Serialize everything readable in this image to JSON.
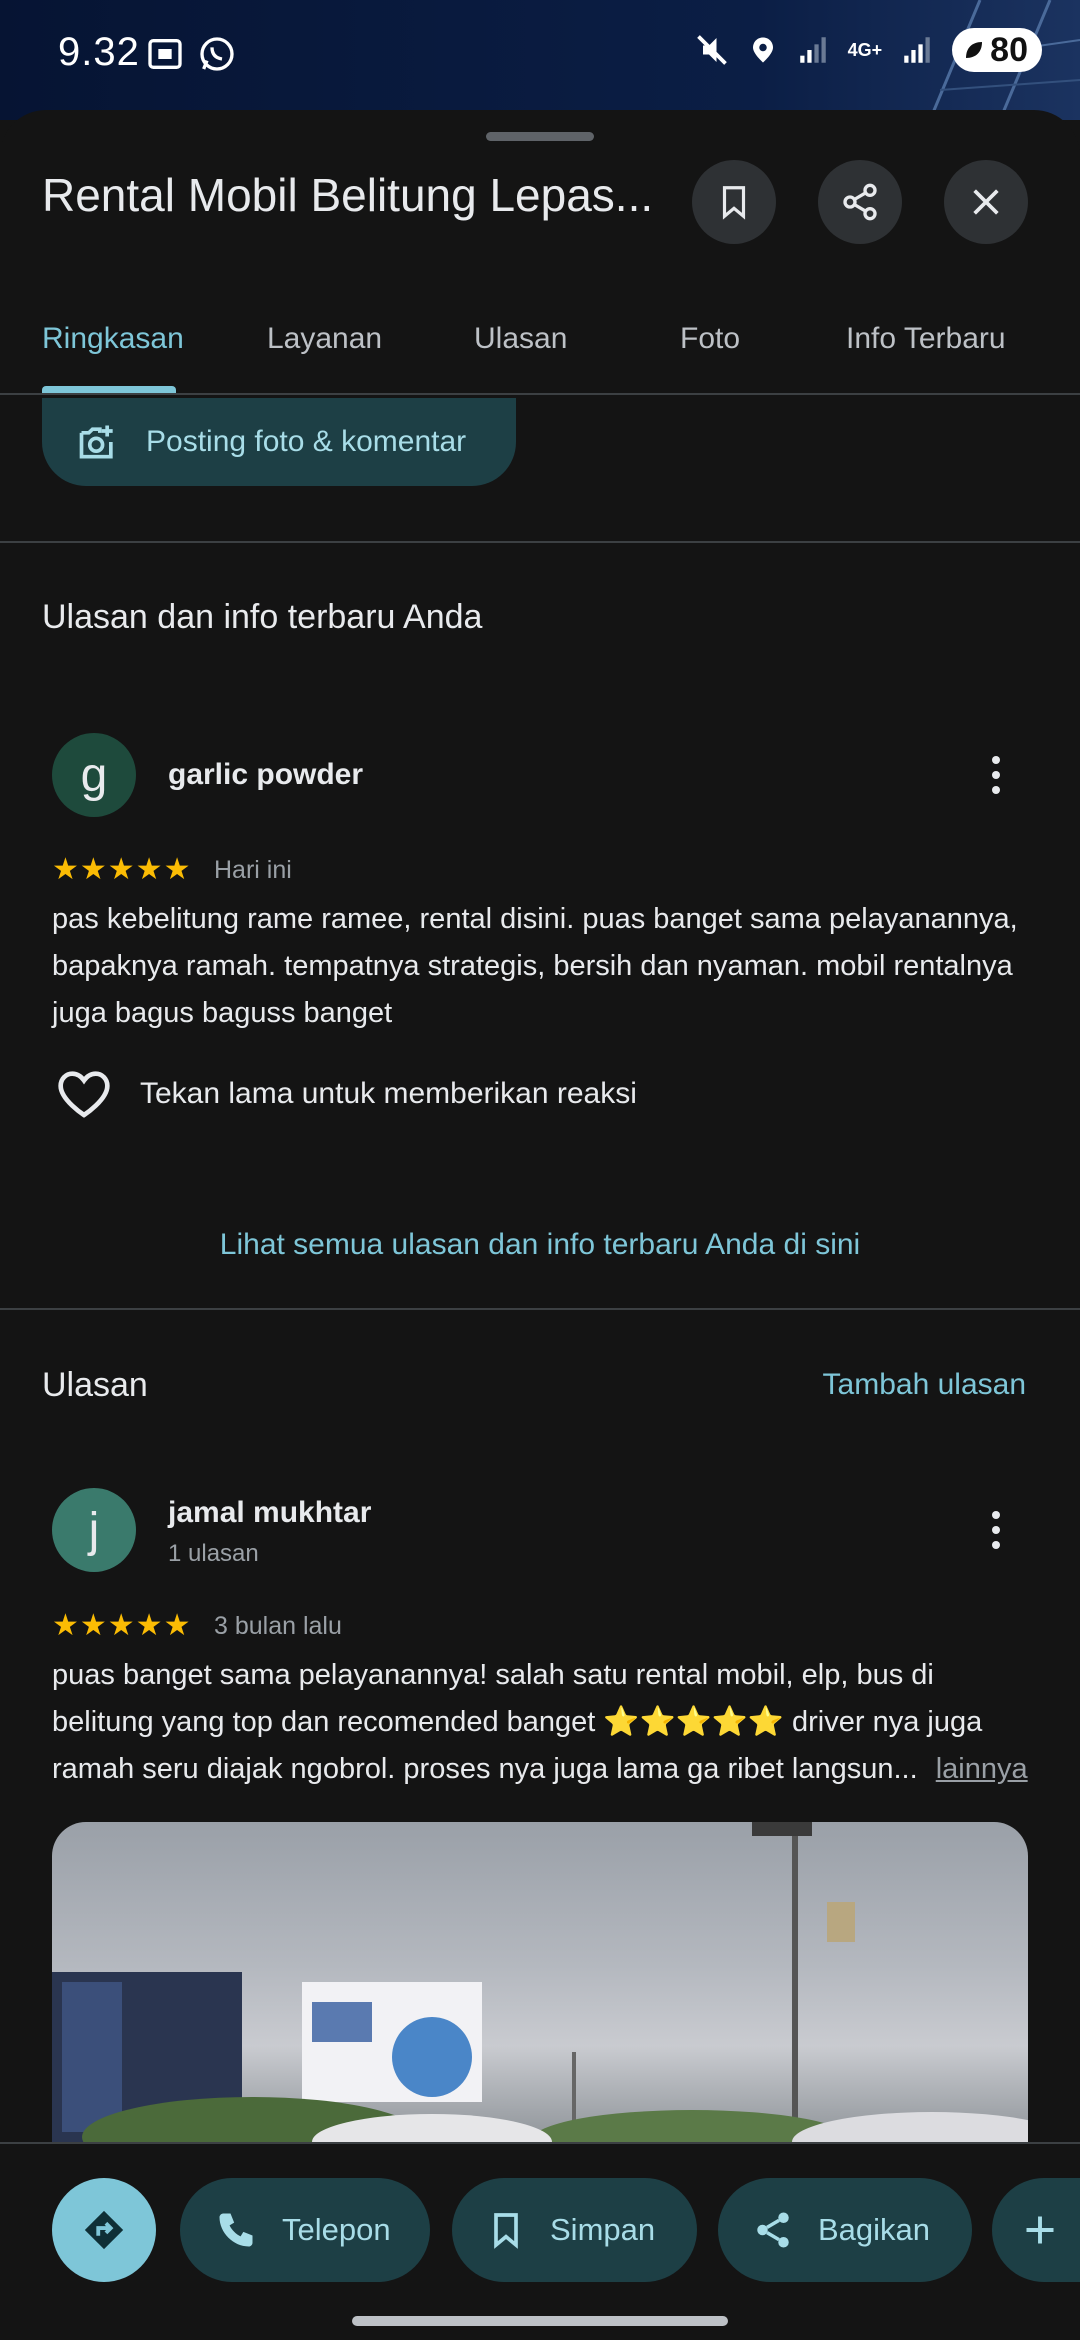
{
  "status_bar": {
    "time": "9.32",
    "network": "4G+",
    "battery": "80"
  },
  "place": {
    "title": "Rental Mobil Belitung Lepas..."
  },
  "tabs": [
    {
      "label": "Ringkasan",
      "active": true
    },
    {
      "label": "Layanan"
    },
    {
      "label": "Ulasan"
    },
    {
      "label": "Foto"
    },
    {
      "label": "Info Terbaru"
    }
  ],
  "post_button": {
    "label": "Posting foto & komentar"
  },
  "your_reviews": {
    "title": "Ulasan dan info terbaru Anda",
    "review": {
      "avatar_letter": "g",
      "name": "garlic powder",
      "stars": "★★★★★",
      "when": "Hari ini",
      "text": "pas kebelitung rame ramee, rental disini. puas banget sama pelayanannya, bapaknya ramah. tempatnya strategis, bersih dan nyaman. mobil rentalnya juga bagus baguss banget",
      "react_hint": "Tekan lama untuk memberikan reaksi"
    },
    "see_all": "Lihat semua ulasan dan info terbaru Anda di sini"
  },
  "reviews": {
    "title": "Ulasan",
    "add_label": "Tambah ulasan",
    "items": [
      {
        "avatar_letter": "j",
        "name": "jamal mukhtar",
        "sub": "1 ulasan",
        "stars": "★★★★★",
        "when": "3 bulan lalu",
        "text": "puas banget sama pelayanannya! salah satu rental mobil, elp, bus di belitung yang top dan recomended banget ⭐⭐⭐⭐⭐ driver nya juga ramah seru diajak ngobrol. proses nya juga lama ga ribet langsun...",
        "more": "lainnya"
      }
    ]
  },
  "actions": [
    {
      "label": "Telepon"
    },
    {
      "label": "Simpan"
    },
    {
      "label": "Bagikan"
    }
  ],
  "colors": {
    "accent": "#7ec6d8",
    "pill_bg": "#1d3f45",
    "star": "#fbbc04"
  }
}
